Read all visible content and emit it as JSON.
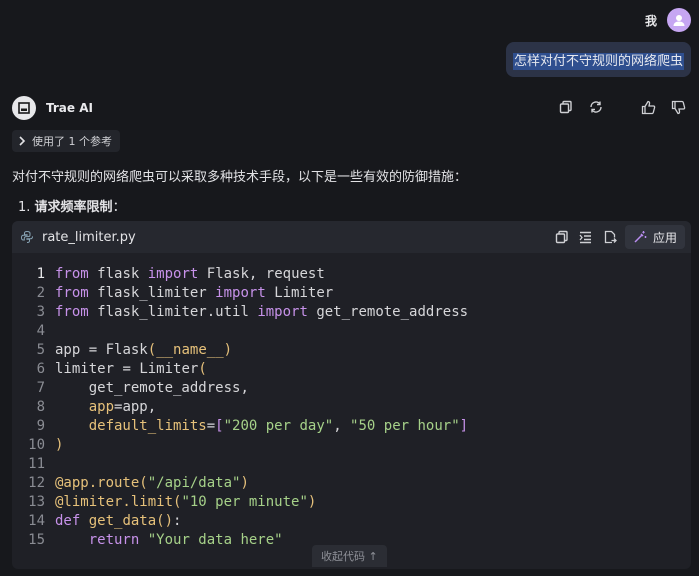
{
  "user": {
    "name": "我",
    "message": "怎样对付不守规则的网络爬虫"
  },
  "assistant": {
    "name": "Trae AI",
    "refs_label": "使用了 1 个参考",
    "intro": "对付不守规则的网络爬虫可以采取多种技术手段，以下是一些有效的防御措施：",
    "item1_num": "1.",
    "item1_title": "请求频率限制",
    "item1_colon": "："
  },
  "code": {
    "filename": "rate_limiter.py",
    "apply_label": "应用",
    "collapse_label": "收起代码 ↑",
    "line_numbers": [
      "1",
      "2",
      "3",
      "4",
      "5",
      "6",
      "7",
      "8",
      "9",
      "10",
      "11",
      "12",
      "13",
      "14",
      "15"
    ],
    "tokens": {
      "from": "from",
      "import": "import",
      "def": "def",
      "flask": "flask",
      "Flask": "Flask",
      "request": "request",
      "flask_limiter": "flask_limiter",
      "Limiter": "Limiter",
      "flask_limiter_util": "flask_limiter.util",
      "get_remote_address": "get_remote_address",
      "app": "app",
      "name": "__name__",
      "limiter": "limiter",
      "app_kw": "app",
      "default_limits": "default_limits",
      "s200": "\"200 per day\"",
      "s50": "\"50 per hour\"",
      "decor_route": "@app.route",
      "s_api": "\"/api/data\"",
      "decor_limit": "@limiter.limit",
      "s10": "\"10 per minute\"",
      "get_data": "get_data",
      "return": "return",
      "s_ret": "\"Your data here\""
    }
  }
}
